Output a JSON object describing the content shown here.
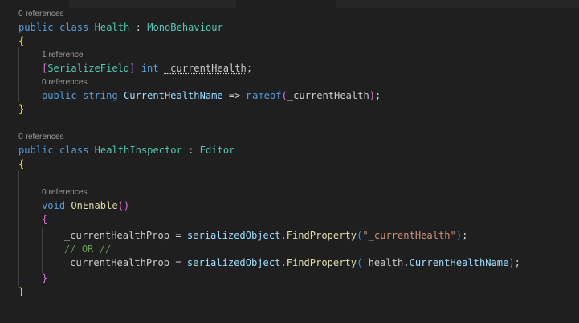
{
  "code_lens": {
    "health_class": "0 references",
    "current_health_field": "1 reference",
    "current_health_name_prop": "0 references",
    "inspector_class": "0 references",
    "on_enable": "0 references"
  },
  "tokens": {
    "public": "public",
    "class": "class",
    "string": "string",
    "int": "int",
    "void": "void",
    "nameof": "nameof",
    "health": "Health",
    "mono_behaviour": "MonoBehaviour",
    "colon": ":",
    "open_brace": "{",
    "close_brace": "}",
    "open_bracket": "[",
    "close_bracket": "]",
    "serialize_field": "SerializeField",
    "current_health_field": "_currentHealth",
    "semicolon": ";",
    "current_health_name": "CurrentHealthName",
    "arrow": "=>",
    "open_paren": "(",
    "close_paren": ")",
    "paren_pair": "()",
    "health_inspector": "HealthInspector",
    "editor": "Editor",
    "on_enable": "OnEnable",
    "current_health_prop": "_currentHealthProp",
    "equals": "=",
    "serialized_object": "serializedObject",
    "dot": ".",
    "find_property": "FindProperty",
    "current_health_string": "\"_currentHealth\"",
    "comment_or": "// OR //",
    "health_field_ref": "_health",
    "current_health_name_member": "CurrentHealthName"
  }
}
